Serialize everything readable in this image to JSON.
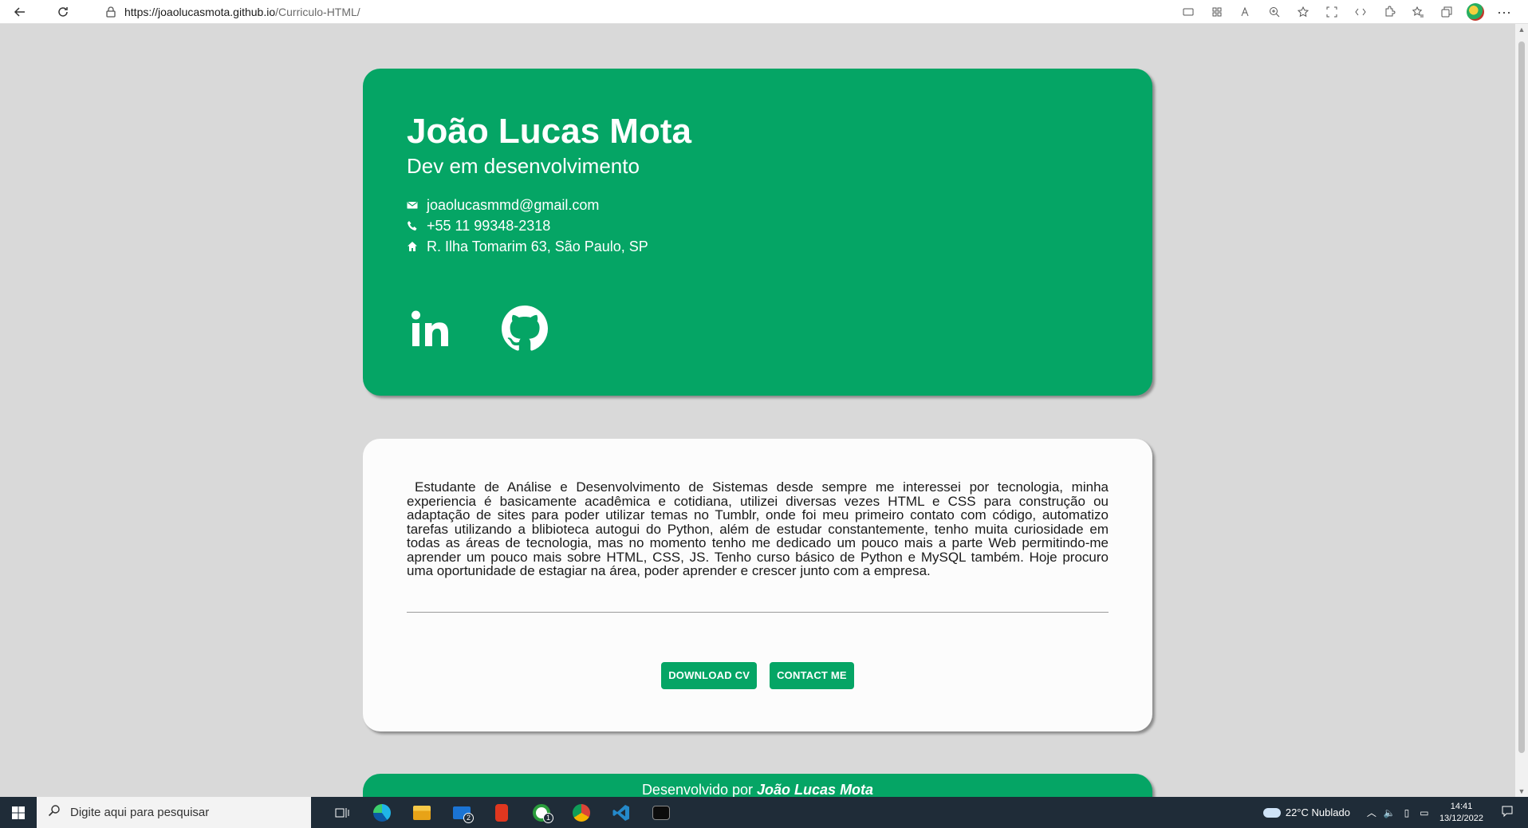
{
  "browser": {
    "url_host": "https://joaolucasmota.github.io",
    "url_path": "/Curriculo-HTML/"
  },
  "header": {
    "name": "João Lucas Mota",
    "role": "Dev em desenvolvimento",
    "email": "joaolucasmmd@gmail.com",
    "phone": "+55 11 99348-2318",
    "address": "R. Ilha Tomarim 63, São Paulo, SP"
  },
  "about": {
    "text": "Estudante de Análise e Desenvolvimento de Sistemas desde sempre me interessei por tecnologia, minha experiencia é basicamente acadêmica e cotidiana, utilizei diversas vezes HTML e CSS para construção ou adaptação de sites para poder utilizar temas no Tumblr, onde foi meu primeiro contato com código, automatizo tarefas utilizando a blibioteca autogui do Python, além de estudar constantemente, tenho muita curiosidade em todas as áreas de tecnologia, mas no momento tenho me dedicado um pouco mais a parte Web permitindo-me aprender um pouco mais sobre HTML, CSS, JS. Tenho curso básico de Python e MySQL também. Hoje procuro uma oportunidade de estagiar na área, poder aprender e crescer junto com a empresa."
  },
  "buttons": {
    "download": "Download CV",
    "contact": "Contact me"
  },
  "footer": {
    "prefix": "Desenvolvido por",
    "author": "João Lucas Mota"
  },
  "taskbar": {
    "search_placeholder": "Digite aqui para pesquisar",
    "mail_badge": "2",
    "xbox_badge": "1",
    "weather": "22°C  Nublado",
    "time": "14:41",
    "date": "13/12/2022"
  },
  "colors": {
    "accent": "#05a565",
    "background": "#d9d9d9",
    "card": "#fcfcfc"
  }
}
